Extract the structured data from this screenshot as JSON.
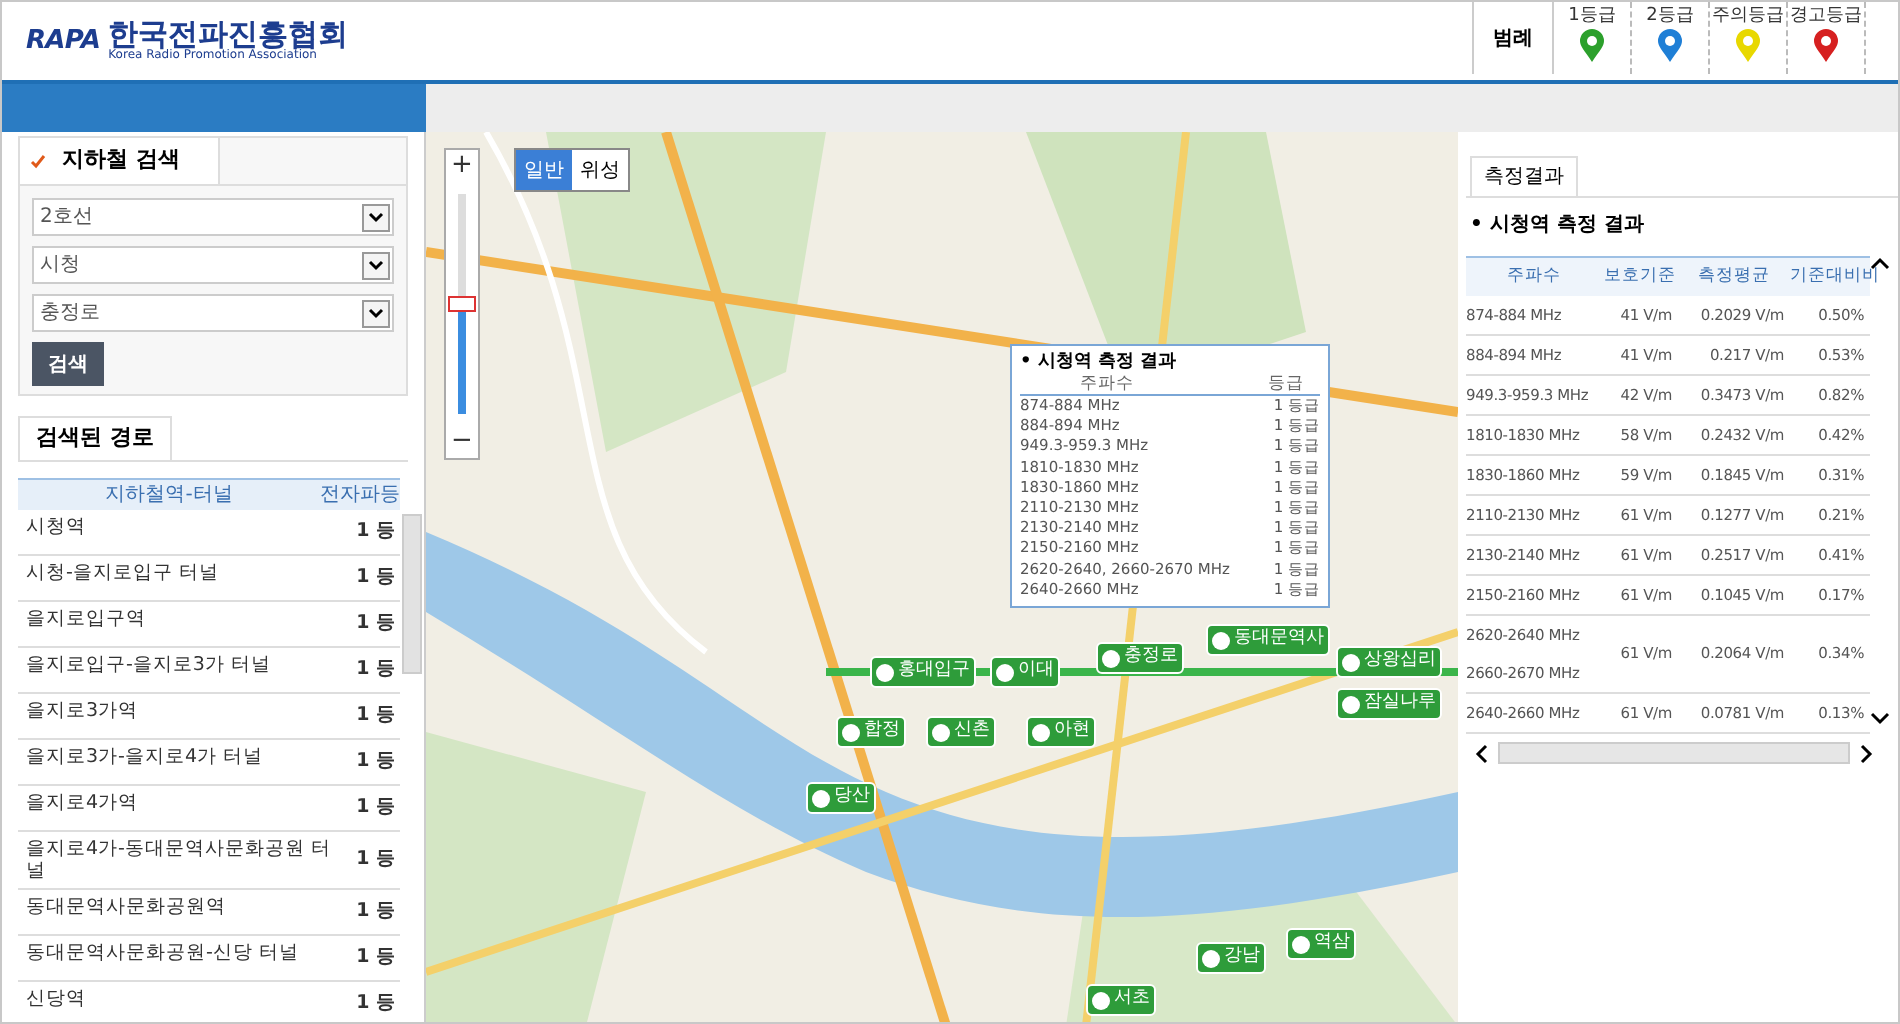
{
  "logo": {
    "mark": "RAPA",
    "name": "한국전파진흥협회",
    "subtitle": "Korea Radio Promotion Association"
  },
  "legend": {
    "title": "범례",
    "items": [
      {
        "label": "1등급",
        "color": "#2ca02c"
      },
      {
        "label": "2등급",
        "color": "#1f7fd6"
      },
      {
        "label": "주의등급",
        "color": "#e8d800"
      },
      {
        "label": "경고등급",
        "color": "#d62020"
      }
    ]
  },
  "search": {
    "tab": "지하철 검색",
    "selects": [
      "2호선",
      "시청",
      "충정로"
    ],
    "button": "검색"
  },
  "routes": {
    "tab": "검색된 경로",
    "columns": [
      "지하철역-터널",
      "전자파등"
    ],
    "rows": [
      {
        "name": "시청역",
        "grade": "1 등"
      },
      {
        "name": "시청-을지로입구 터널",
        "grade": "1 등"
      },
      {
        "name": "을지로입구역",
        "grade": "1 등"
      },
      {
        "name": "을지로입구-을지로3가 터널",
        "grade": "1 등"
      },
      {
        "name": "을지로3가역",
        "grade": "1 등"
      },
      {
        "name": "을지로3가-을지로4가 터널",
        "grade": "1 등"
      },
      {
        "name": "을지로4가역",
        "grade": "1 등"
      },
      {
        "name": "을지로4가-동대문역사문화공원 터널",
        "grade": "1 등"
      },
      {
        "name": "동대문역사문화공원역",
        "grade": "1 등"
      },
      {
        "name": "동대문역사문화공원-신당 터널",
        "grade": "1 등"
      },
      {
        "name": "신당역",
        "grade": "1 등"
      }
    ]
  },
  "map": {
    "zoom_in": "+",
    "zoom_out": "−",
    "zoom": {
      "level": 0.5
    },
    "types": [
      {
        "label": "일반",
        "selected": true
      },
      {
        "label": "위성",
        "selected": false
      }
    ],
    "markers": [
      "당산",
      "합정",
      "홍대입구",
      "신촌",
      "이대",
      "아현",
      "충정로",
      "동대문역사",
      "상왕십리",
      "잠실나루",
      "강남",
      "역삼",
      "서초"
    ],
    "popup": {
      "title": "• 시청역 측정 결과",
      "columns": [
        "주파수",
        "등급"
      ],
      "rows": [
        [
          "874-884 MHz",
          "1 등급"
        ],
        [
          "884-894 MHz",
          "1 등급"
        ],
        [
          "949.3-959.3 MHz",
          "1 등급"
        ],
        [
          "1810-1830 MHz",
          "1 등급"
        ],
        [
          "1830-1860 MHz",
          "1 등급"
        ],
        [
          "2110-2130 MHz",
          "1 등급"
        ],
        [
          "2130-2140 MHz",
          "1 등급"
        ],
        [
          "2150-2160 MHz",
          "1 등급"
        ],
        [
          "2620-2640, 2660-2670 MHz",
          "1 등급"
        ],
        [
          "2640-2660 MHz",
          "1 등급"
        ]
      ]
    }
  },
  "results": {
    "tab": "측정결과",
    "title": "• 시청역 측정 결과",
    "columns": [
      "주파수",
      "보호기준",
      "측정평균",
      "기준대비비"
    ],
    "rows": [
      [
        "874-884 MHz",
        "41 V/m",
        "0.2029 V/m",
        "0.50%"
      ],
      [
        "884-894 MHz",
        "41 V/m",
        "0.217 V/m",
        "0.53%"
      ],
      [
        "949.3-959.3 MHz",
        "42 V/m",
        "0.3473 V/m",
        "0.82%"
      ],
      [
        "1810-1830 MHz",
        "58 V/m",
        "0.2432 V/m",
        "0.42%"
      ],
      [
        "1830-1860 MHz",
        "59 V/m",
        "0.1845 V/m",
        "0.31%"
      ],
      [
        "2110-2130 MHz",
        "61 V/m",
        "0.1277 V/m",
        "0.21%"
      ],
      [
        "2130-2140 MHz",
        "61 V/m",
        "0.2517 V/m",
        "0.41%"
      ],
      [
        "2150-2160 MHz",
        "61 V/m",
        "0.1045 V/m",
        "0.17%"
      ],
      [
        "2620-2640 MHz 2660-2670 MHz",
        "61 V/m",
        "0.2064 V/m",
        "0.34%"
      ],
      [
        "2640-2660 MHz",
        "61 V/m",
        "0.0781 V/m",
        "0.13%"
      ]
    ]
  }
}
